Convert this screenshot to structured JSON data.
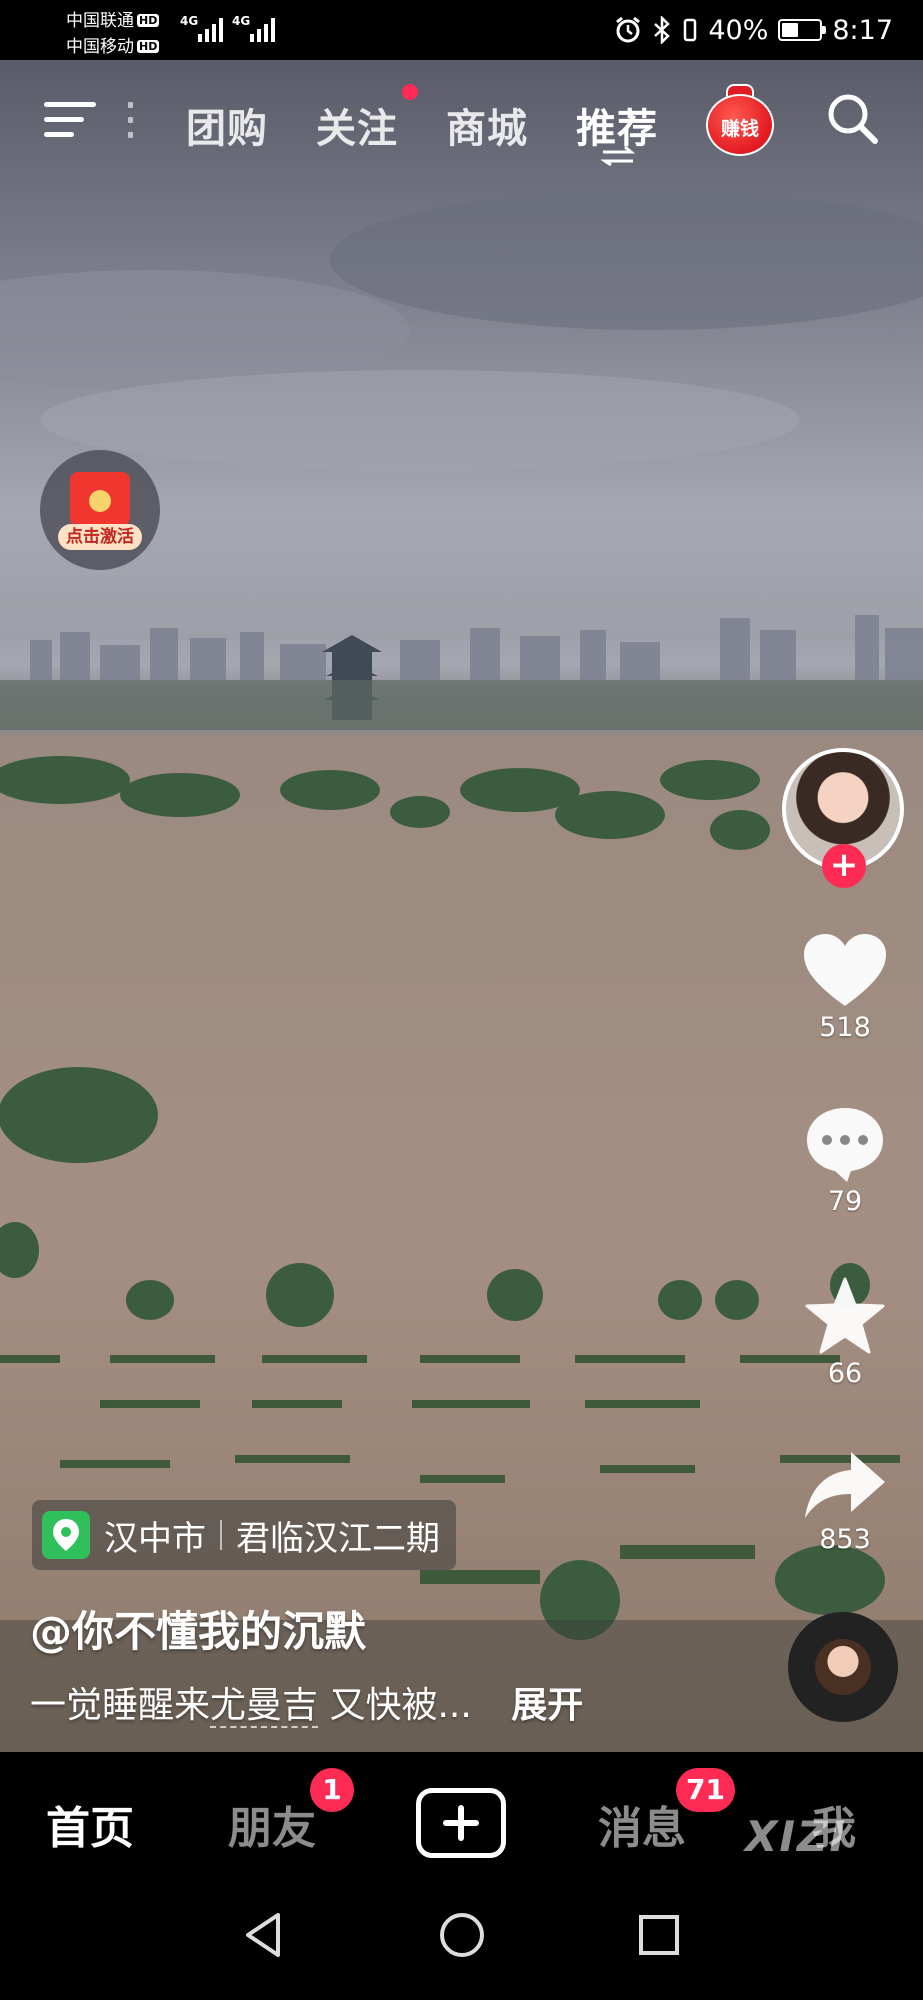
{
  "status_bar": {
    "carrier_1": "中国联通",
    "carrier_2": "中国移动",
    "hd_label": "HD",
    "network": "4G",
    "battery": "40%",
    "battery_level": 0.4,
    "time": "8:17"
  },
  "top_nav": {
    "tabs": [
      {
        "label": "团购"
      },
      {
        "label": "关注"
      },
      {
        "label": "商城"
      },
      {
        "label": "推荐"
      }
    ],
    "earn_label": "赚钱"
  },
  "red_packet": {
    "label": "点击激活"
  },
  "side_actions": {
    "likes": "518",
    "comments": "79",
    "favorites": "66",
    "shares": "853"
  },
  "video": {
    "location_city": "汉中市",
    "location_place": "君临汉江二期",
    "author": "@你不懂我的沉默",
    "description": "一觉睡醒来",
    "music_name": "尤曼吉",
    "description_tail": "又快被...",
    "expand": "展开"
  },
  "bottom_tabs": {
    "home": "首页",
    "friends": "朋友",
    "friends_badge": "1",
    "messages": "消息",
    "messages_badge": "71",
    "me": "我",
    "watermark": "XIZI"
  },
  "colors": {
    "accent": "#fe2c55",
    "location_pin": "#2fbf5b",
    "earn_red": "#e21a22"
  }
}
